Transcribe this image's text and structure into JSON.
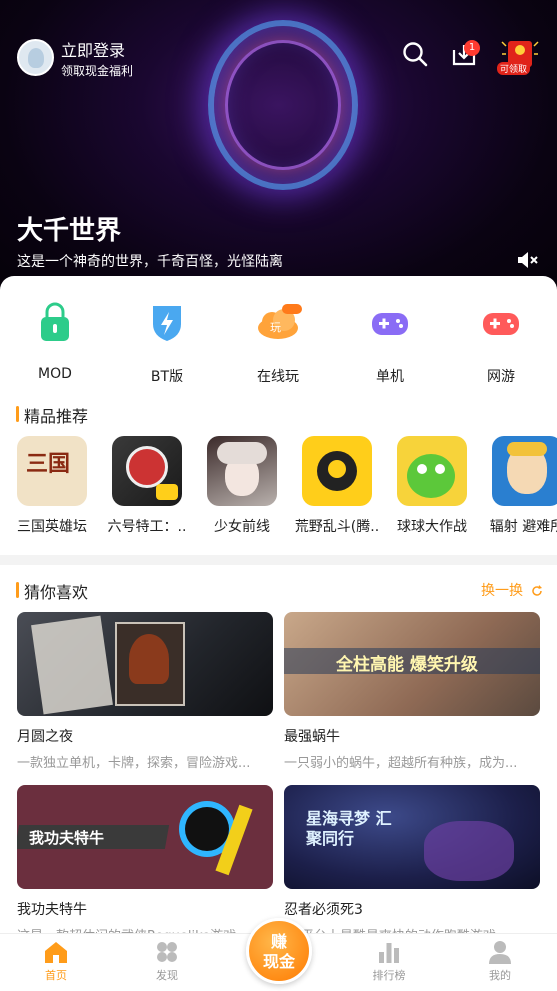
{
  "header": {
    "login_title": "立即登录",
    "login_sub": "领取现金福利",
    "download_badge": "1",
    "redpack_label": "可领取"
  },
  "hero": {
    "title": "大千世界",
    "description": "这是一个神奇的世界，千奇百怪，光怪陆离"
  },
  "categories": [
    {
      "label": "MOD",
      "icon": "lock-bag-icon",
      "color": "#2dcc8a"
    },
    {
      "label": "BT版",
      "icon": "shield-bolt-icon",
      "color": "#4aa8f0"
    },
    {
      "label": "在线玩",
      "icon": "cloud-play-icon",
      "color": "#ffa33a"
    },
    {
      "label": "单机",
      "icon": "gamepad-icon",
      "color": "#8a6cf5"
    },
    {
      "label": "网游",
      "icon": "gamepad-icon",
      "color": "#ff5a5a"
    }
  ],
  "featured": {
    "title": "精品推荐",
    "items": [
      {
        "name": "三国英雄坛",
        "icon_text": "三国"
      },
      {
        "name": "六号特工：.."
      },
      {
        "name": "少女前线"
      },
      {
        "name": "荒野乱斗(腾.."
      },
      {
        "name": "球球大作战"
      },
      {
        "name": "辐射 避难所"
      }
    ]
  },
  "guess": {
    "title": "猜你喜欢",
    "swap_label": "换一换",
    "cards": [
      {
        "title": "月圆之夜",
        "desc": "一款独立单机，卡牌，探索，冒险游戏..."
      },
      {
        "title": "最强蜗牛",
        "desc": "一只弱小的蜗牛，超越所有种族，成为...",
        "banner_text": "全柱高能 爆笑升级"
      },
      {
        "title": "我功夫特牛",
        "desc": "这是一款超休闲的武侠Roguelike游戏...",
        "banner_text": "我功夫特牛"
      },
      {
        "title": "忍者必须死3",
        "desc": "PC平台上最酷最爽快的动作跑酷游戏...",
        "banner_text": "星海寻梦 汇聚同行"
      }
    ]
  },
  "nav": {
    "items": [
      {
        "label": "首页",
        "active": true
      },
      {
        "label": "发现",
        "active": false
      },
      {
        "label": "排行榜",
        "active": false
      },
      {
        "label": "我的",
        "active": false
      }
    ],
    "earn_label_1": "赚",
    "earn_label_2": "现金"
  }
}
